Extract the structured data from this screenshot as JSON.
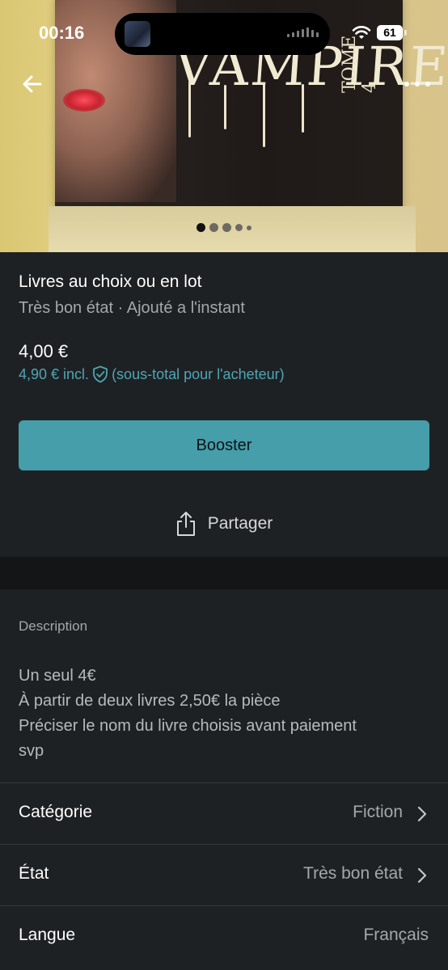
{
  "status_bar": {
    "time": "00:16",
    "battery": "61"
  },
  "hero": {
    "cover_title": "VAMPIRE",
    "cover_subtitle": "TOME 4",
    "carousel": {
      "count": 5,
      "active_index": 0
    }
  },
  "item": {
    "title": "Livres au choix ou en lot",
    "subtitle": "Très bon état · Ajouté a l'instant",
    "price": "4,00 €",
    "price_incl": "4,90 € incl.",
    "price_incl_note": "(sous-total pour l'acheteur)"
  },
  "actions": {
    "boost_label": "Booster",
    "share_label": "Partager"
  },
  "description": {
    "label": "Description",
    "lines": [
      "Un seul 4€",
      "À partir de deux livres 2,50€ la pièce",
      "Préciser le nom du livre choisis avant paiement",
      "svp"
    ]
  },
  "details": [
    {
      "label": "Catégorie",
      "value": "Fiction",
      "chevron": true
    },
    {
      "label": "État",
      "value": "Très bon état",
      "chevron": true
    },
    {
      "label": "Langue",
      "value": "Français",
      "chevron": false
    }
  ],
  "colors": {
    "background": "#1e2124",
    "accent": "#459ea9",
    "accent_text": "#4fa6b3",
    "muted_text": "#a5a8ab"
  },
  "icons": [
    "back-arrow-icon",
    "more-icon",
    "shield-check-icon",
    "share-icon",
    "chevron-right-icon",
    "wifi-icon",
    "battery-icon"
  ]
}
